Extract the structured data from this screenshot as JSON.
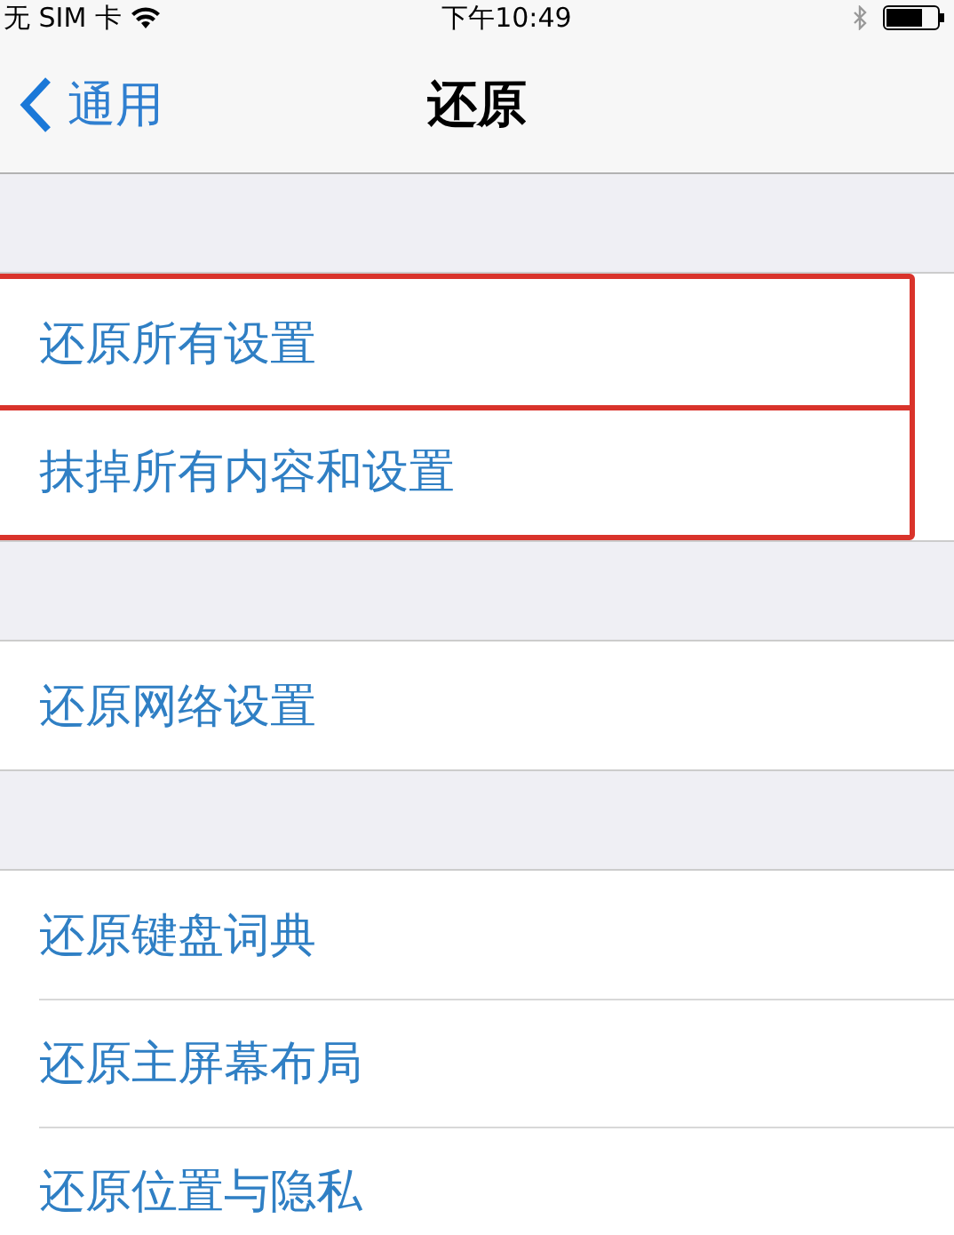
{
  "status_bar": {
    "carrier": "无 SIM 卡",
    "time": "下午10:49"
  },
  "nav": {
    "back_label": "通用",
    "title": "还原"
  },
  "groups": [
    {
      "highlighted": true,
      "items": [
        "还原所有设置",
        "抹掉所有内容和设置"
      ]
    },
    {
      "highlighted": false,
      "items": [
        "还原网络设置"
      ]
    },
    {
      "highlighted": false,
      "items": [
        "还原键盘词典",
        "还原主屏幕布局",
        "还原位置与隐私"
      ]
    }
  ]
}
